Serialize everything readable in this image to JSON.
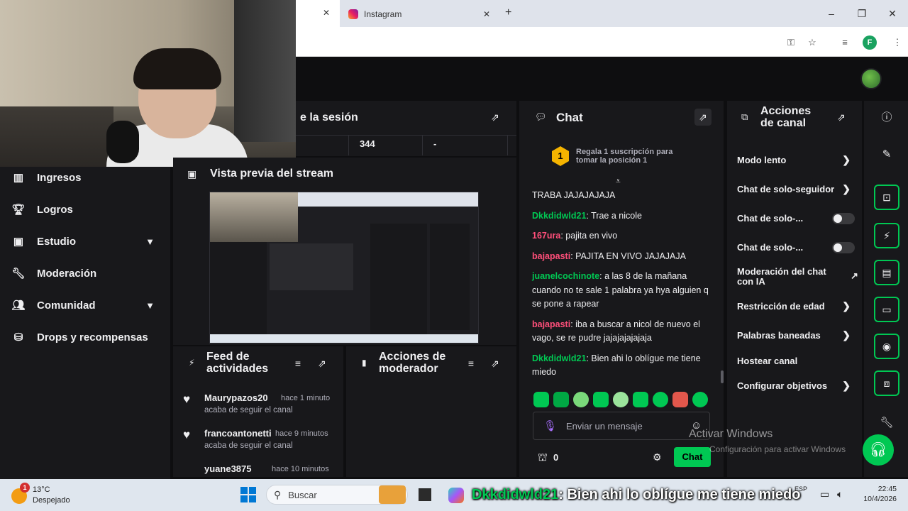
{
  "browser": {
    "tab_title": "Instagram",
    "tab_close": "✕",
    "new_tab": "+",
    "active_tab_close": "✕",
    "minimize": "–",
    "maximize": "❐",
    "close": "✕",
    "profile_initial": "F"
  },
  "nav": {
    "items": [
      {
        "label": "Ingresos",
        "icon": "bar-chart-icon"
      },
      {
        "label": "Logros",
        "icon": "trophy-icon"
      },
      {
        "label": "Estudio",
        "icon": "studio-icon"
      },
      {
        "label": "Moderación",
        "icon": "wrench-icon"
      },
      {
        "label": "Comunidad",
        "icon": "people-icon"
      },
      {
        "label": "Drops y recompensas",
        "icon": "drops-icon"
      }
    ]
  },
  "session": {
    "title": "e la sesión",
    "stats": [
      "344",
      "-"
    ]
  },
  "preview": {
    "title": "Vista previa del stream"
  },
  "feed": {
    "title_line1": "Feed de",
    "title_line2": "actividades",
    "items": [
      {
        "user": "Maurypazos20",
        "time": "hace 1 minuto",
        "action": "acaba de seguir el canal"
      },
      {
        "user": "francoantonetti",
        "time": "hace 9 minutos",
        "action": "acaba de seguir el canal"
      },
      {
        "user": "yuane3875",
        "time": "hace 10 minutos",
        "action": ""
      }
    ]
  },
  "mod_actions": {
    "title_line1": "Acciones de",
    "title_line2": "moderador"
  },
  "chat": {
    "title": "Chat",
    "gift_rank": "1",
    "gift_line1": "Regala 1 suscripción para",
    "gift_line2": "tomar la posición 1",
    "first_line": "TRABA JAJAJAJAJA",
    "messages": [
      {
        "user": "Dkkdidwld21",
        "color": "#00c853",
        "text": ": Trae a nicole"
      },
      {
        "user": "167ura",
        "color": "#ff4f7a",
        "text": ": pajita en vivo"
      },
      {
        "user": "bajapasti",
        "color": "#ff4f7a",
        "text": ": PAJITA EN VIVO JAJAJAJA"
      },
      {
        "user": "juanelcochinote",
        "color": "#00c853",
        "text": ": a las 8 de la mañana cuando no te sale 1 palabra ya hya alguien q se pone a rapear"
      },
      {
        "user": "bajapasti",
        "color": "#ff4f7a",
        "text": ": iba a buscar a nicol de nuevo el vago, se re pudre jajajajajajaja"
      },
      {
        "user": "Dkkdidwld21",
        "color": "#00c853",
        "text": ": Bien ahi lo oblígue me tiene miedo"
      }
    ],
    "input_placeholder": "Enviar un mensaje",
    "points": "0",
    "send_label": "Chat"
  },
  "canal": {
    "title_line1": "Acciones",
    "title_line2": "de canal",
    "items": [
      {
        "label": "Modo lento",
        "right": "›"
      },
      {
        "label": "Chat de solo-seguidor",
        "right": "›"
      },
      {
        "label": "Chat de solo-...",
        "right": "toggle"
      },
      {
        "label": "Chat de solo-...",
        "right": "toggle"
      },
      {
        "label": "Moderación del chat con IA",
        "right": "↗"
      },
      {
        "label": "Restricción de edad",
        "right": "›"
      },
      {
        "label": "Palabras baneadas",
        "right": "›"
      },
      {
        "label": "Hostear canal",
        "right": ""
      },
      {
        "label": "Configurar objetivos",
        "right": "›"
      }
    ]
  },
  "overlay": {
    "user": "Dkkdidwld21",
    "text": ": Bien ahi lo oblígue me tiene miedo"
  },
  "watermark": {
    "line1": "Activar Windows",
    "line2": "Configuración para activar Windows"
  },
  "taskbar": {
    "weather_badge": "1",
    "temperature": "13°C",
    "condition": "Despejado",
    "search_label": "Buscar",
    "lang": "ESP",
    "time": "22:45",
    "date": "10/4/2026"
  },
  "colors": {
    "accent": "#00c853",
    "panel": "#18181b",
    "background": "#0e0e10"
  }
}
